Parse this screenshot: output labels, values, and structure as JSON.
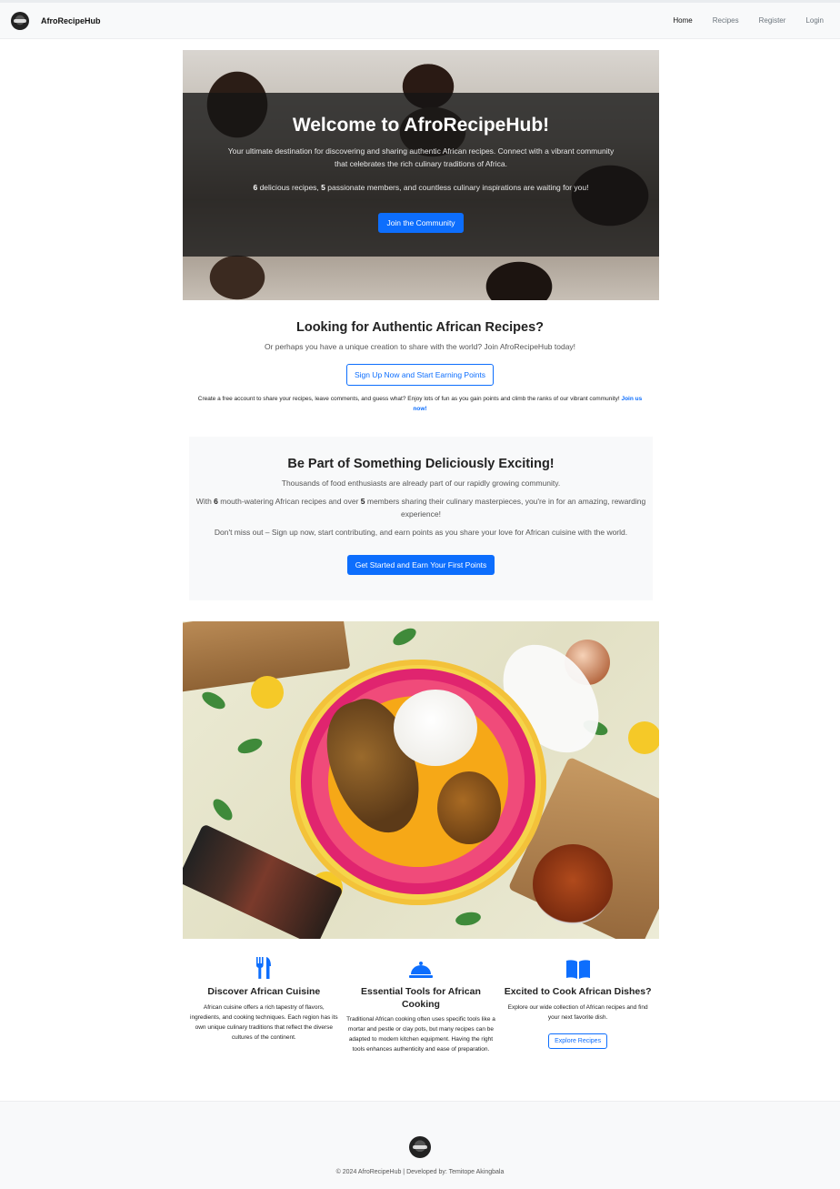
{
  "navbar": {
    "brand": "AfroRecipeHub",
    "links": [
      "Home",
      "Recipes",
      "Register",
      "Login"
    ],
    "active": "Home"
  },
  "hero": {
    "title": "Welcome to AfroRecipeHub!",
    "intro": "Your ultimate destination for discovering and sharing authentic African recipes. Connect with a vibrant community that celebrates the rich culinary traditions of Africa.",
    "recipes_count": "6",
    "stats_mid": " delicious recipes, ",
    "members_count": "5",
    "stats_tail": " passionate members, and countless culinary inspirations are waiting for you!",
    "cta": "Join the Community"
  },
  "signup": {
    "title": "Looking for Authentic African Recipes?",
    "lead": "Or perhaps you have a unique creation to share with the world? Join AfroRecipeHub today!",
    "button": "Sign Up Now and Start Earning Points",
    "note": "Create a free account to share your recipes, leave comments, and guess what? Enjoy lots of fun as you gain points and climb the ranks of our vibrant community! ",
    "note_link": "Join us now!"
  },
  "community": {
    "title": "Be Part of Something Deliciously Exciting!",
    "line1": "Thousands of food enthusiasts are already part of our rapidly growing community.",
    "line2_a": "With ",
    "recipes_count": "6",
    "line2_b": " mouth-watering African recipes and over ",
    "members_count": "5",
    "line2_c": " members sharing their culinary masterpieces, you're in for an amazing, rewarding experience!",
    "line3": "Don't miss out – Sign up now, start contributing, and earn points as you share your love for African cuisine with the world.",
    "button": "Get Started and Earn Your First Points"
  },
  "features": [
    {
      "icon": "utensils-icon",
      "title": "Discover African Cuisine",
      "text": "African cuisine offers a rich tapestry of flavors, ingredients, and cooking techniques. Each region has its own unique culinary traditions that reflect the diverse cultures of the continent."
    },
    {
      "icon": "cloche-icon",
      "title": "Essential Tools for African Cooking",
      "text": "Traditional African cooking often uses specific tools like a mortar and pestle or clay pots, but many recipes can be adapted to modern kitchen equipment. Having the right tools enhances authenticity and ease of preparation."
    },
    {
      "icon": "book-icon",
      "title": "Excited to Cook African Dishes?",
      "text": "Explore our wide collection of African recipes and find your next favorite dish.",
      "button": "Explore Recipes"
    }
  ],
  "footer": {
    "copyright": "© 2024 AfroRecipeHub | Developed by: Temitope Akingbala"
  },
  "colors": {
    "primary": "#0d6efd",
    "light_bg": "#f8f9fa",
    "text": "#212529"
  }
}
